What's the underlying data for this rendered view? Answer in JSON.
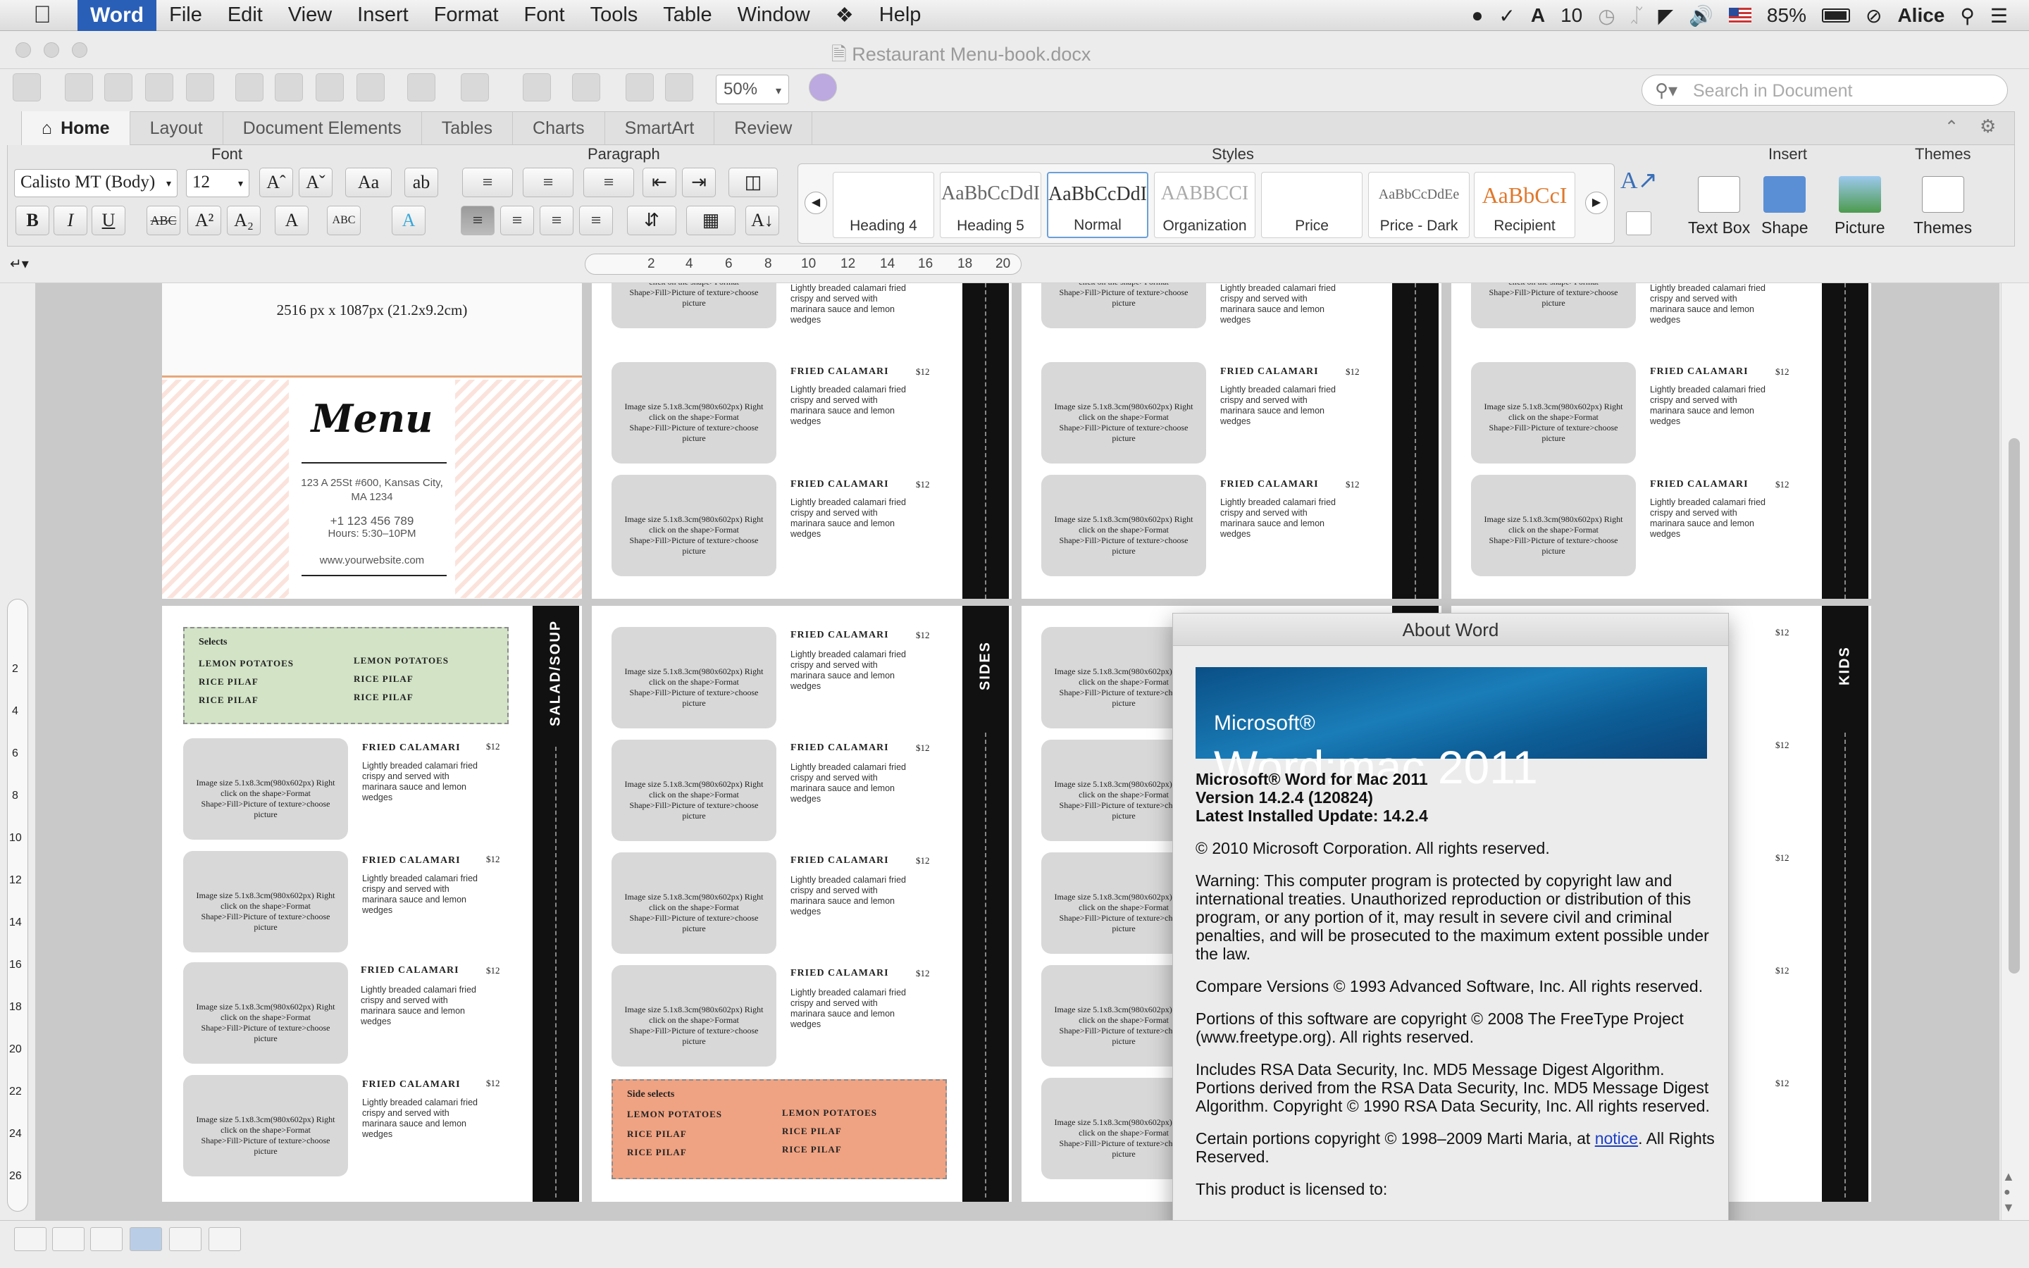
{
  "menubar": {
    "app": "Word",
    "items": [
      "File",
      "Edit",
      "View",
      "Insert",
      "Format",
      "Font",
      "Tools",
      "Table",
      "Window",
      "Help"
    ],
    "status": {
      "adobe_count": "10",
      "battery": "85%",
      "user": "Alice"
    }
  },
  "window": {
    "title": "Restaurant Menu-book.docx"
  },
  "toolbar": {
    "zoom": "50%",
    "search_placeholder": "Search in Document"
  },
  "ribbon": {
    "tabs": [
      "Home",
      "Layout",
      "Document Elements",
      "Tables",
      "Charts",
      "SmartArt",
      "Review"
    ],
    "groups": {
      "font": "Font",
      "paragraph": "Paragraph",
      "styles": "Styles",
      "insert": "Insert",
      "themes": "Themes"
    },
    "font_name": "Calisto MT (Body)",
    "font_size": "12",
    "styles": [
      {
        "sample": "",
        "name": "Heading 4"
      },
      {
        "sample": "AaBbCcDdI",
        "name": "Heading 5"
      },
      {
        "sample": "AaBbCcDdI",
        "name": "Normal"
      },
      {
        "sample": "AABBCCI",
        "name": "Organization"
      },
      {
        "sample": "",
        "name": "Price"
      },
      {
        "sample": "AaBbCcDdEe",
        "name": "Price - Dark"
      },
      {
        "sample": "AaBbCcI",
        "name": "Recipient"
      }
    ],
    "insert": {
      "textbox": "Text Box",
      "shape": "Shape",
      "picture": "Picture",
      "themes": "Themes"
    }
  },
  "document": {
    "cover": {
      "size_note": "2516 px x 1087px (21.2x9.2cm)",
      "title": "Menu",
      "address_1": "123  A 25St #600, Kansas City,",
      "address_2": "MA 1234",
      "phone": "+1 123 456 789",
      "hours": "Hours: 5:30–10PM",
      "website": "www.yourwebsite.com"
    },
    "card": {
      "image_note": "Image size 5.1x8.3cm(980x602px) Right click on the shape>Format Shape>Fill>Picture of texture>choose picture",
      "dish": "FRIED CALAMARI",
      "price": "$12",
      "desc": "Lightly breaded calamari fried crispy and served with marinara sauce and lemon wedges"
    },
    "selects": {
      "title": "Selects",
      "items": [
        "LEMON POTATOES",
        "LEMON POTATOES",
        "RICE PILAF",
        "RICE PILAF",
        "RICE PILAF",
        "RICE PILAF"
      ]
    },
    "side_selects": {
      "title": "Side selects",
      "items": [
        "LEMON POTATOES",
        "LEMON POTATOES",
        "RICE PILAF",
        "RICE PILAF",
        "RICE PILAF",
        "RICE PILAF"
      ]
    },
    "bands": {
      "salad": "SALAD/SOUP",
      "sides": "SIDES",
      "kids": "KIDS"
    },
    "ruler_numbers": [
      "2",
      "4",
      "6",
      "8",
      "10",
      "12",
      "14",
      "16",
      "18",
      "20"
    ],
    "vruler_numbers": [
      "2",
      "4",
      "6",
      "8",
      "10",
      "12",
      "14",
      "16",
      "18",
      "20",
      "22",
      "24",
      "26"
    ]
  },
  "about": {
    "title": "About Word",
    "banner_small": "Microsoft®",
    "banner": "Word:mac 2011",
    "product": "Microsoft® Word for Mac 2011",
    "version": "Version 14.2.4 (120824)",
    "update": "Latest Installed Update: 14.2.4",
    "copyright": "© 2010 Microsoft Corporation. All rights reserved.",
    "warning": "Warning: This computer program is protected by copyright law and international treaties.  Unauthorized reproduction or distribution of this program, or any portion of it, may result in severe civil and criminal penalties, and will be prosecuted to the maximum extent possible under the law.",
    "compare": "Compare Versions © 1993 Advanced Software, Inc.  All rights reserved.",
    "freetype": "Portions of this software are copyright © 2008 The FreeType Project (www.freetype.org).  All rights reserved.",
    "rsa": "Includes RSA Data Security, Inc. MD5 Message Digest Algorithm. Portions derived from the RSA Data Security, Inc. MD5 Message Digest Algorithm.  Copyright © 1990 RSA Data Security, Inc. All rights reserved.",
    "maria_pre": "Certain portions copyright © 1998–2009  Marti Maria, at ",
    "maria_link": "notice",
    "maria_post": ".  All Rights Reserved.",
    "licensed": "This product is licensed to:"
  }
}
